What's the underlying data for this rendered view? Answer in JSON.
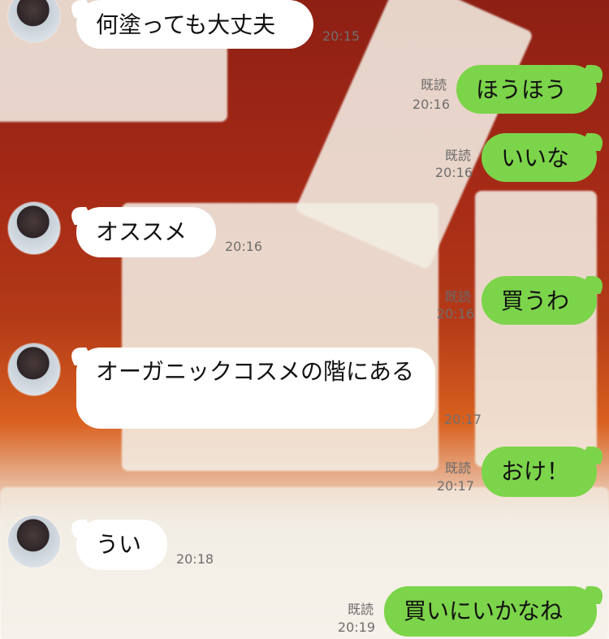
{
  "messages": [
    {
      "side": "left",
      "text": "何塗っても大丈夫",
      "time": "20:15"
    },
    {
      "side": "right",
      "text": "ほうほう",
      "status": "既読",
      "time": "20:16"
    },
    {
      "side": "right",
      "text": "いいな",
      "status": "既読",
      "time": "20:16"
    },
    {
      "side": "left",
      "text": "オススメ",
      "time": "20:16"
    },
    {
      "side": "right",
      "text": "買うわ",
      "status": "既読",
      "time": "20:16"
    },
    {
      "side": "left",
      "text": "オーガニックコスメの階にある",
      "time": "20:17"
    },
    {
      "side": "right",
      "text": "おけ！",
      "status": "既読",
      "time": "20:17"
    },
    {
      "side": "left",
      "text": "うい",
      "time": "20:18"
    },
    {
      "side": "right",
      "text": "買いにいかなね",
      "status": "既読",
      "time": "20:19"
    }
  ]
}
